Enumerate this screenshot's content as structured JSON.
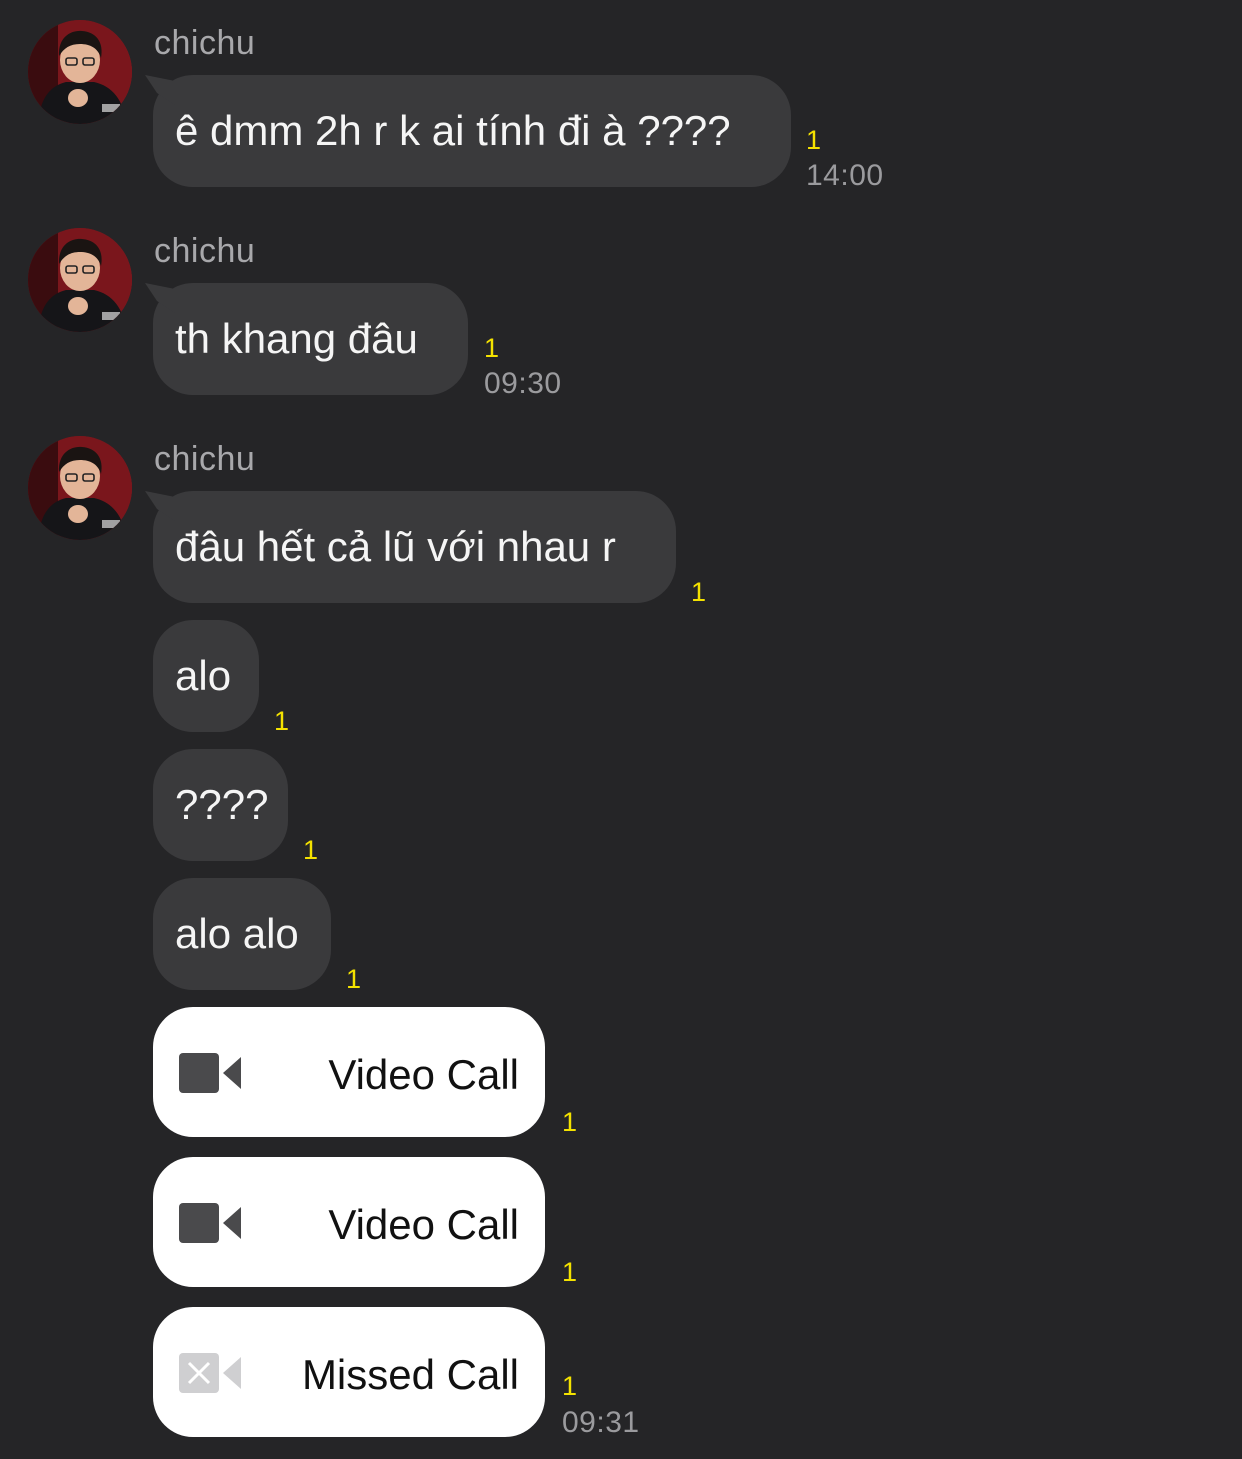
{
  "colors": {
    "background": "#252527",
    "bubble": "#3a3a3c",
    "read_indicator": "#f4e200",
    "call_card": "#ffffff"
  },
  "messages": [
    {
      "sender": "chichu",
      "text": "ê dmm 2h r k ai tính đi à ????",
      "read": "1",
      "time": "14:00"
    },
    {
      "sender": "chichu",
      "text": "th khang đâu",
      "read": "1",
      "time": "09:30"
    },
    {
      "sender": "chichu",
      "text": "đâu hết cả lũ với nhau r",
      "read": "1"
    },
    {
      "text": "alo",
      "read": "1"
    },
    {
      "text": "????",
      "read": "1"
    },
    {
      "text": "alo alo",
      "read": "1"
    }
  ],
  "calls": [
    {
      "label": "Video Call",
      "icon": "video-camera-icon",
      "read": "1"
    },
    {
      "label": "Video Call",
      "icon": "video-camera-icon",
      "read": "1"
    },
    {
      "label": "Missed Call",
      "icon": "missed-video-call-icon",
      "read": "1",
      "time": "09:31"
    }
  ]
}
